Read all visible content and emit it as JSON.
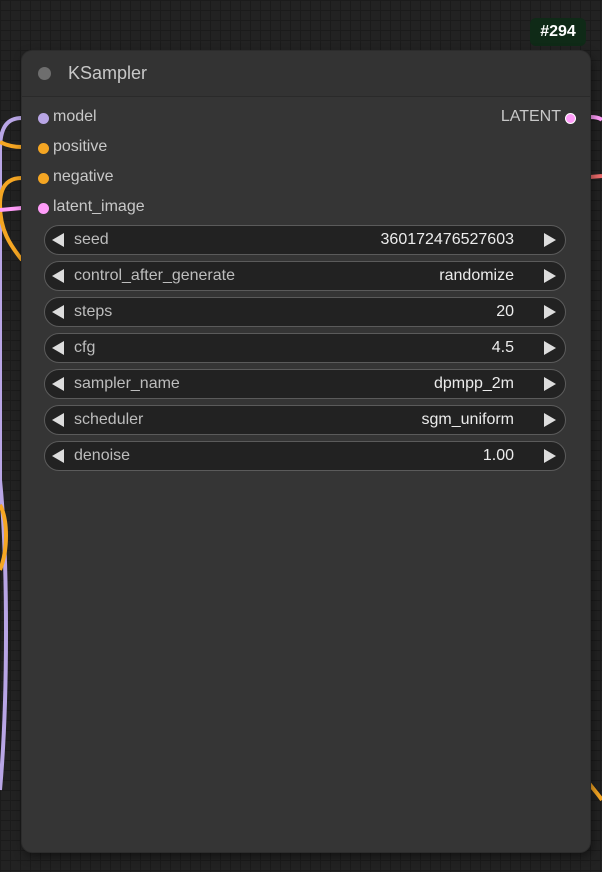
{
  "node": {
    "id_badge": "#294",
    "title": "KSampler",
    "inputs": [
      {
        "label": "model",
        "color": "#b9a6e6"
      },
      {
        "label": "positive",
        "color": "#f5a623"
      },
      {
        "label": "negative",
        "color": "#f5a623"
      },
      {
        "label": "latent_image",
        "color": "#ff9cf9"
      }
    ],
    "outputs": [
      {
        "label": "LATENT",
        "color": "#ff9cf9"
      }
    ],
    "widgets": [
      {
        "name": "seed",
        "value": "360172476527603"
      },
      {
        "name": "control_after_generate",
        "value": "randomize"
      },
      {
        "name": "steps",
        "value": "20"
      },
      {
        "name": "cfg",
        "value": "4.5"
      },
      {
        "name": "sampler_name",
        "value": "dpmpp_2m"
      },
      {
        "name": "scheduler",
        "value": "sgm_uniform"
      },
      {
        "name": "denoise",
        "value": "1.00"
      }
    ]
  },
  "wire_colors": {
    "model": "#b9a6e6",
    "conditioning": "#f5a623",
    "latent": "#ff9cf9",
    "other": "#ee6b6b"
  }
}
